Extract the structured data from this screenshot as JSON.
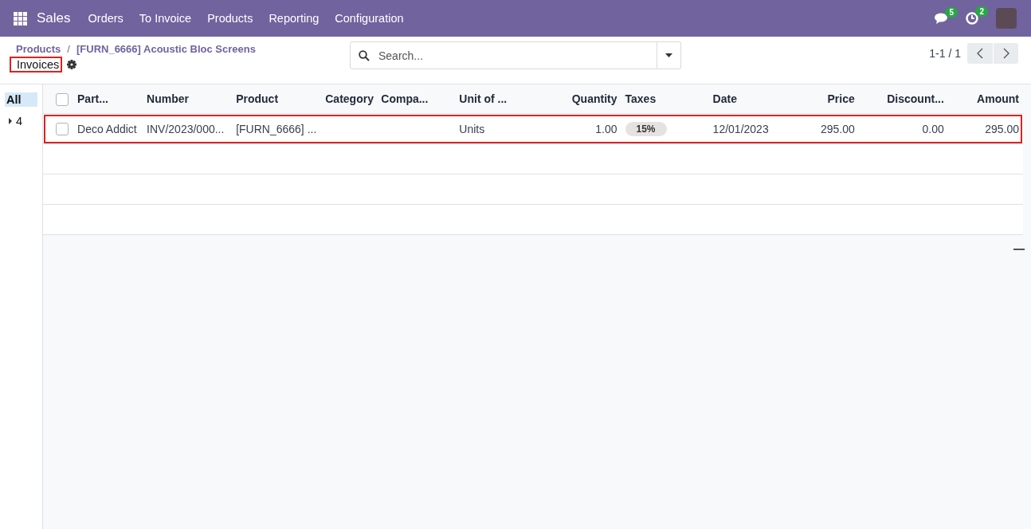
{
  "navbar": {
    "app_name": "Sales",
    "menu": [
      "Orders",
      "To Invoice",
      "Products",
      "Reporting",
      "Configuration"
    ],
    "messages_badge": "5",
    "activities_badge": "2"
  },
  "breadcrumb": {
    "items": [
      "Products",
      "[FURN_6666] Acoustic Bloc Screens"
    ],
    "separator": "/",
    "title": "Invoices",
    "title_highlighted": true
  },
  "search": {
    "placeholder": "Search..."
  },
  "pager": {
    "text": "1-1 / 1"
  },
  "sidebar": {
    "items": [
      {
        "label": "All",
        "selected": true
      },
      {
        "label": "4",
        "selected": false,
        "expanded": false
      }
    ]
  },
  "table": {
    "select_all_checked": false,
    "columns": [
      {
        "label": "Part...",
        "kind": "text"
      },
      {
        "label": "Number",
        "kind": "text"
      },
      {
        "label": "Product",
        "kind": "text"
      },
      {
        "label": "Category",
        "kind": "text"
      },
      {
        "label": "Compa...",
        "kind": "text"
      },
      {
        "label": "Unit of ...",
        "kind": "text"
      },
      {
        "label": "Quantity",
        "kind": "number"
      },
      {
        "label": "Taxes",
        "kind": "text"
      },
      {
        "label": "Date",
        "kind": "text"
      },
      {
        "label": "Price",
        "kind": "number"
      },
      {
        "label": "Discount...",
        "kind": "number"
      },
      {
        "label": "Amount",
        "kind": "number"
      }
    ],
    "rows": [
      {
        "selected": false,
        "highlighted": true,
        "cells": [
          {
            "kind": "text",
            "text": "Deco Addict"
          },
          {
            "kind": "text",
            "text": "INV/2023/000..."
          },
          {
            "kind": "text",
            "text": "[FURN_6666] ..."
          },
          {
            "kind": "blank"
          },
          {
            "kind": "blank"
          },
          {
            "kind": "text",
            "text": "Units"
          },
          {
            "kind": "text",
            "text": "1.00"
          },
          {
            "kind": "tags",
            "tags": [
              "15%"
            ]
          },
          {
            "kind": "text",
            "text": "12/01/2023"
          },
          {
            "kind": "text",
            "text": "295.00"
          },
          {
            "kind": "text",
            "text": "0.00"
          },
          {
            "kind": "text",
            "text": "295.00"
          }
        ]
      }
    ]
  }
}
